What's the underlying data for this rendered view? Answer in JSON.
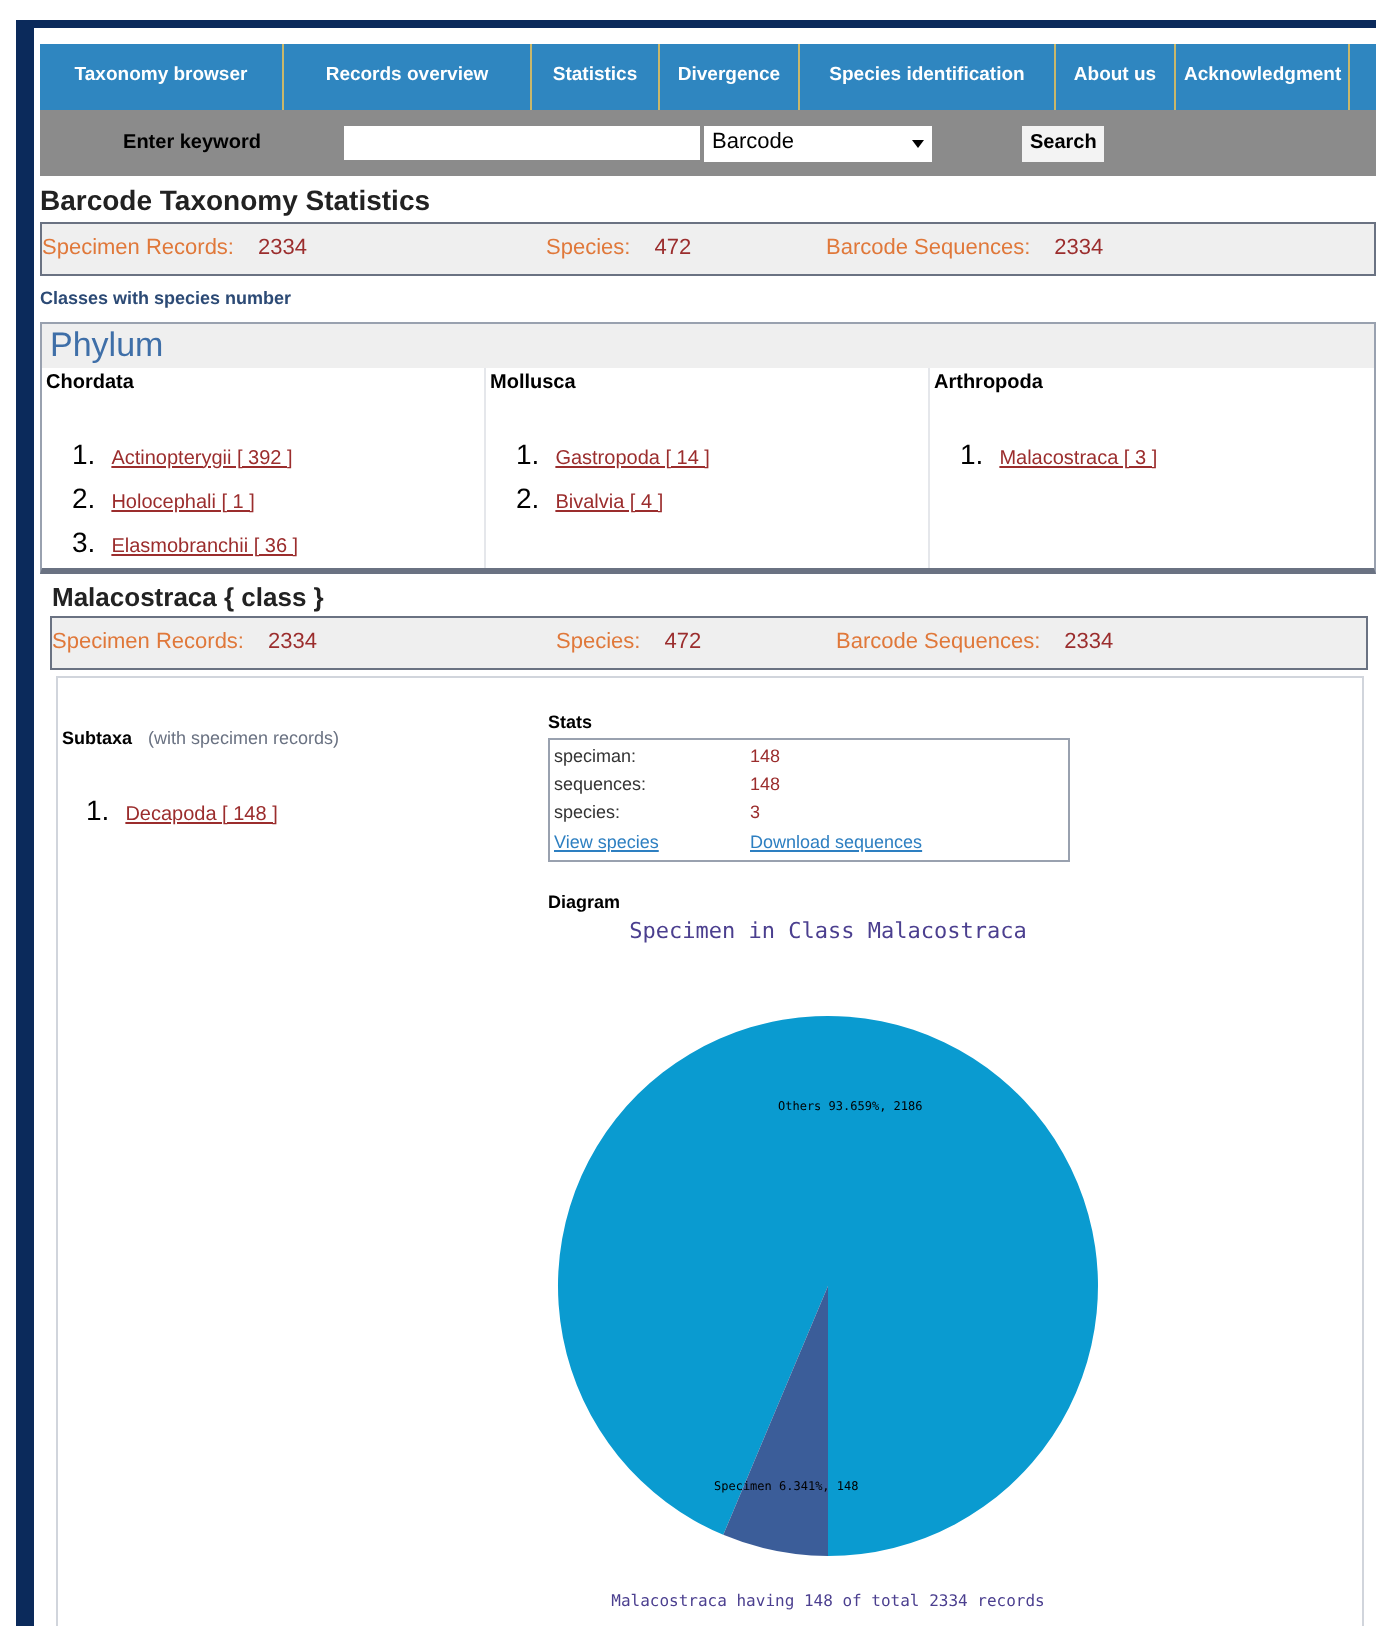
{
  "nav": [
    {
      "label": "Taxonomy browser",
      "selected": false
    },
    {
      "label": "Records overview",
      "selected": false
    },
    {
      "label": "Statistics",
      "selected": false
    },
    {
      "label": "Divergence",
      "selected": false
    },
    {
      "label": "Species identification",
      "selected": false
    },
    {
      "label": "About us",
      "selected": false
    },
    {
      "label": "Acknowledgment",
      "selected": false
    }
  ],
  "search": {
    "label": "Enter keyword",
    "type_value": "Barcode",
    "button": "Search"
  },
  "title": "Barcode Taxonomy Statistics",
  "summary": [
    {
      "label": "Specimen Records:",
      "value": "2334"
    },
    {
      "label": "Species:",
      "value": "472"
    },
    {
      "label": "Barcode Sequences:",
      "value": "2334"
    }
  ],
  "classes_heading": "Classes with species number",
  "phylum": {
    "heading": "Phylum",
    "columns": [
      {
        "name": "Chordata",
        "items": [
          {
            "number": "1.",
            "link": "Actinopterygii [ 392 ]"
          },
          {
            "number": "2.",
            "link": "Holocephali [ 1 ]"
          },
          {
            "number": "3.",
            "link": "Elasmobranchii [ 36 ]"
          }
        ]
      },
      {
        "name": "Mollusca",
        "items": [
          {
            "number": "1.",
            "link": "Gastropoda [ 14 ]"
          },
          {
            "number": "2.",
            "link": "Bivalvia [ 4 ]"
          }
        ]
      },
      {
        "name": "Arthropoda",
        "items": [
          {
            "number": "1.",
            "link": "Malacostraca [ 3 ]"
          }
        ]
      }
    ]
  },
  "class_title": "Malacostraca { class }",
  "class_summary": [
    {
      "label": "Specimen Records:",
      "value": "2334"
    },
    {
      "label": "Species:",
      "value": "472"
    },
    {
      "label": "Barcode Sequences:",
      "value": "2334"
    }
  ],
  "subtaxa": {
    "heading": "Subtaxa",
    "note": "(with specimen records)",
    "items": [
      {
        "number": "1.",
        "link": "Decapoda [ 148 ]"
      }
    ]
  },
  "stats": {
    "heading": "Stats",
    "rows": [
      {
        "label": "speciman:",
        "value": "148"
      },
      {
        "label": "sequences:",
        "value": "148"
      },
      {
        "label": "species:",
        "value": "3"
      }
    ],
    "links": [
      "View species",
      "Download sequences"
    ]
  },
  "diagram": {
    "heading": "Diagram",
    "caption": "Malacostraca having 148 of total 2334 records",
    "chart_data": {
      "type": "pie",
      "title": "Specimen in Class Malacostraca",
      "categories": [
        "Others",
        "Specimen"
      ],
      "values": [
        2186,
        148
      ],
      "value_labels": [
        "93.659%, 2186",
        "6.341%, 148"
      ]
    }
  }
}
